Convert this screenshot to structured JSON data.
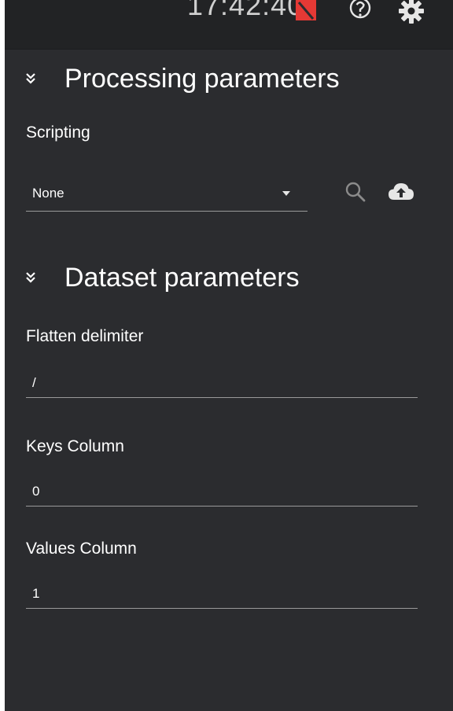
{
  "topbar": {
    "clock": "17:42:40",
    "icons": [
      "warning-icon",
      "help-icon",
      "gear-icon"
    ],
    "warning_color": "#e53935"
  },
  "processing": {
    "title": "Processing parameters",
    "scripting_label": "Scripting",
    "scripting_value": "None"
  },
  "dataset": {
    "title": "Dataset parameters",
    "flatten_label": "Flatten delimiter",
    "flatten_value": "/",
    "keys_label": "Keys Column",
    "keys_value": "0",
    "values_label": "Values Column",
    "values_value": "1"
  }
}
